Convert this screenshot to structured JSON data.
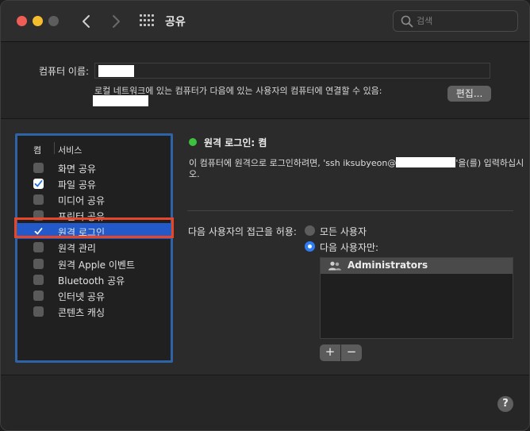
{
  "window": {
    "title": "공유",
    "search_placeholder": "검색"
  },
  "computer": {
    "name_label": "컴퓨터 이름:",
    "network_note": "로컬 네트워크에 있는 컴퓨터가 다음에 있는 사용자의 컴퓨터에 연결할 수 있음:",
    "edit_label": "편집..."
  },
  "services": {
    "header_on": "켬",
    "header_service": "서비스",
    "items": [
      {
        "label": "화면 공유",
        "checked": false,
        "selected": false
      },
      {
        "label": "파일 공유",
        "checked": true,
        "selected": false
      },
      {
        "label": "미디어 공유",
        "checked": false,
        "selected": false
      },
      {
        "label": "프린터 공유",
        "checked": false,
        "selected": false
      },
      {
        "label": "원격 로그인",
        "checked": true,
        "selected": true
      },
      {
        "label": "원격 관리",
        "checked": false,
        "selected": false
      },
      {
        "label": "원격 Apple 이벤트",
        "checked": false,
        "selected": false
      },
      {
        "label": "Bluetooth 공유",
        "checked": false,
        "selected": false
      },
      {
        "label": "인터넷 공유",
        "checked": false,
        "selected": false
      },
      {
        "label": "콘텐츠 캐싱",
        "checked": false,
        "selected": false
      }
    ]
  },
  "detail": {
    "status": "원격 로그인: 켬",
    "status_color": "#3dc23d",
    "ssh_prefix": "이 컴퓨터에 원격으로 로그인하려면, 'ssh iksubyeon@",
    "ssh_suffix": "'을(를) 입력하십시",
    "ssh_line2": "오.",
    "access_label": "다음 사용자의 접근을 허용:",
    "radio_all": "모든 사용자",
    "radio_only": "다음 사용자만:",
    "users": [
      "Administrators"
    ],
    "add_label": "+",
    "remove_label": "−"
  },
  "help_label": "?",
  "colors": {
    "accent": "#2e7cf6",
    "selection": "#2359c8",
    "list_border": "#2e63a7",
    "highlight_border": "#e8462a"
  },
  "icons": {
    "back": "chevron-left-icon",
    "forward": "chevron-right-icon",
    "grid": "grid-icon",
    "search": "search-icon",
    "group": "group-icon",
    "help": "help-icon"
  }
}
